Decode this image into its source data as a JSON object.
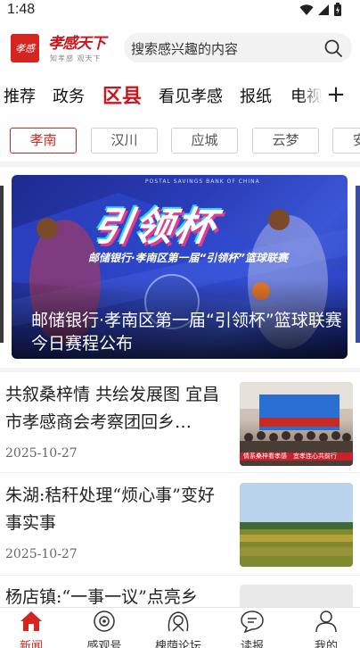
{
  "status": {
    "time": "1:48"
  },
  "header": {
    "logo_badge": "孝感",
    "logo_title": "孝感天下",
    "logo_slogan": "知孝感 观天下",
    "search_placeholder": "搜索感兴趣的内容"
  },
  "channels": {
    "tabs": [
      {
        "label": "推荐",
        "active": false
      },
      {
        "label": "政务",
        "active": false
      },
      {
        "label": "区县",
        "active": true
      },
      {
        "label": "看见孝感",
        "active": false
      },
      {
        "label": "报纸",
        "active": false
      },
      {
        "label": "电视",
        "active": false
      }
    ],
    "more_label": "+"
  },
  "districts": [
    {
      "label": "孝南",
      "active": true
    },
    {
      "label": "汉川",
      "active": false
    },
    {
      "label": "应城",
      "active": false
    },
    {
      "label": "云梦",
      "active": false
    },
    {
      "label": "安",
      "active": false
    }
  ],
  "banner": {
    "org_text": "POSTAL SAVINGS BANK OF CHINA",
    "headline": "引领杯",
    "subline": "邮储银行·孝南区第一届“引领杯”篮球联赛",
    "caption": "邮储银行·孝南区第一届“引领杯”篮球联赛今日赛程公布"
  },
  "news": [
    {
      "title": "共叙桑梓情 共绘发展图 宜昌市孝感商会考察团回乡…",
      "date": "2025-10-27",
      "thumb_banner": "情系桑梓看孝感　宜孝连心共前行"
    },
    {
      "title": "朱湖:秸秆处理“烦心事”变好事实事",
      "date": "2025-10-27"
    },
    {
      "title": "杨店镇:“一事一议”点亮乡",
      "date": ""
    }
  ],
  "bottom_nav": [
    {
      "label": "新闻",
      "icon": "home-icon",
      "active": true
    },
    {
      "label": "感观号",
      "icon": "eye-icon",
      "active": false
    },
    {
      "label": "槐荫论坛",
      "icon": "forum-icon",
      "active": false
    },
    {
      "label": "读报",
      "icon": "chat-icon",
      "active": false
    },
    {
      "label": "我的",
      "icon": "user-icon",
      "active": false
    }
  ],
  "colors": {
    "accent": "#d6251f",
    "brand_red": "#c9161c"
  }
}
